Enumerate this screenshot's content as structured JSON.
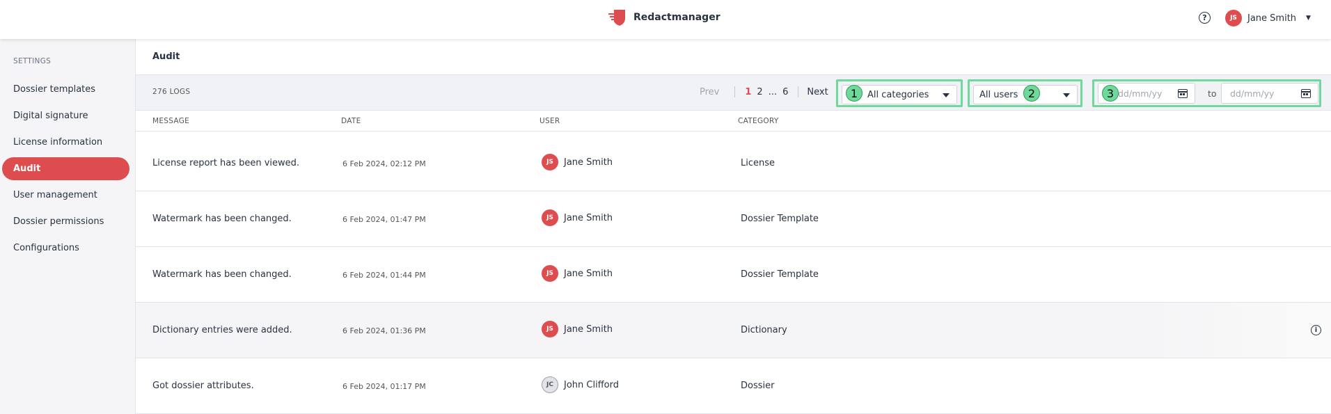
{
  "header": {
    "app_name": "Redactmanager",
    "help_icon": "help-circle-icon",
    "user": {
      "initials": "JS",
      "name": "Jane Smith"
    }
  },
  "sidebar": {
    "title": "SETTINGS",
    "items": [
      {
        "label": "Dossier templates",
        "active": false
      },
      {
        "label": "Digital signature",
        "active": false
      },
      {
        "label": "License information",
        "active": false
      },
      {
        "label": "Audit",
        "active": true
      },
      {
        "label": "User management",
        "active": false
      },
      {
        "label": "Dossier permissions",
        "active": false
      },
      {
        "label": "Configurations",
        "active": false
      }
    ]
  },
  "main": {
    "title": "Audit",
    "logs_count": "276 LOGS",
    "pagination": {
      "prev": "Prev",
      "pages": [
        "1",
        "2",
        "...",
        "6"
      ],
      "current": "1",
      "next": "Next"
    },
    "filters": {
      "category": {
        "badge": "1",
        "value": "All categories"
      },
      "user": {
        "badge": "2",
        "value": "All users"
      },
      "date": {
        "badge": "3",
        "from_placeholder": "dd/mm/yy",
        "to_label": "to",
        "to_placeholder": "dd/mm/yy"
      }
    },
    "columns": [
      "MESSAGE",
      "DATE",
      "USER",
      "CATEGORY"
    ],
    "rows": [
      {
        "message": "License report has been viewed.",
        "date": "6 Feb 2024, 02:12 PM",
        "user_initials": "JS",
        "user": "Jane Smith",
        "category": "License"
      },
      {
        "message": "Watermark has been changed.",
        "date": "6 Feb 2024, 01:47 PM",
        "user_initials": "JS",
        "user": "Jane Smith",
        "category": "Dossier Template"
      },
      {
        "message": "Watermark has been changed.",
        "date": "6 Feb 2024, 01:44 PM",
        "user_initials": "JS",
        "user": "Jane Smith",
        "category": "Dossier Template"
      },
      {
        "message": "Dictionary entries were added.",
        "date": "6 Feb 2024, 01:36 PM",
        "user_initials": "JS",
        "user": "Jane Smith",
        "category": "Dictionary"
      },
      {
        "message": "Got dossier attributes.",
        "date": "6 Feb 2024, 01:17 PM",
        "user_initials": "JC",
        "user": "John Clifford",
        "category": "Dossier"
      }
    ]
  },
  "colors": {
    "accent": "#dd4d50",
    "highlight": "#6fd99b"
  }
}
